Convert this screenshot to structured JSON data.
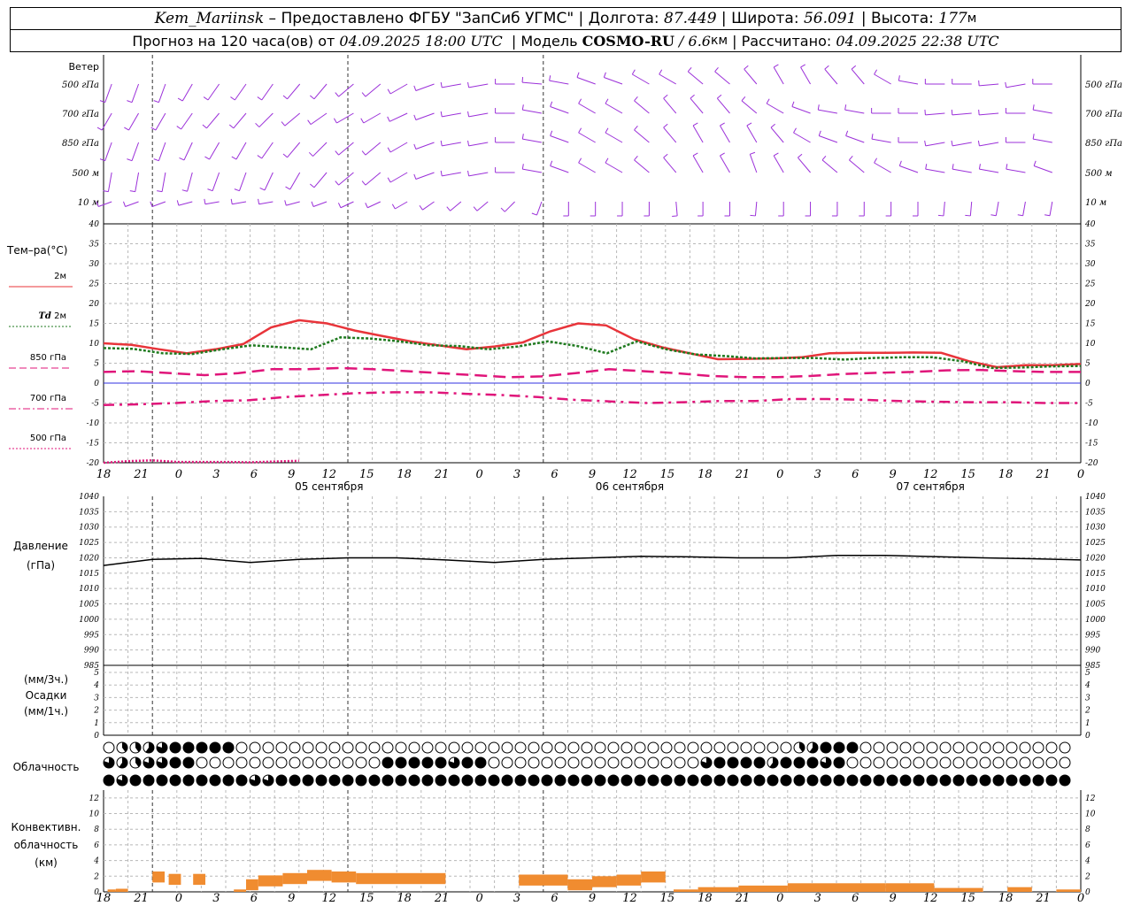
{
  "header": {
    "line1": {
      "station": "Kem_Mariinsk",
      "dash": " – ",
      "provider": "Предоставлено ФГБУ \"ЗапСиб УГМС\"",
      "sep": " | ",
      "lon_label": "Долгота: ",
      "lon_value": "87.449",
      "lat_label": "Широта: ",
      "lat_value": "56.091",
      "alt_label": "Высота: ",
      "alt_value": "177",
      "alt_unit": "м"
    },
    "line2": {
      "forecast_label": "Прогноз на 120 часа(ов) от ",
      "forecast_start": "04.09.2025 18:00 UTC",
      "model_sep": "  | Модель ",
      "model_name": "COSMO-RU",
      "model_res": " / 6.6",
      "model_res_unit": "км",
      "calc_label": " | Рассчитано: ",
      "calc_time": "04.09.2025 22:38 UTC"
    }
  },
  "colors": {
    "wind": "#9b30d9",
    "t2m": "#e8343a",
    "td2m": "#1f7a1f",
    "t850": "#e0157a",
    "zero_line": "#3030e0",
    "pressure": "#000000",
    "convective": "#f08c30",
    "grid": "#b8b8b8"
  },
  "time_axis": {
    "hour_labels": [
      "18",
      "21",
      "0",
      "3",
      "6",
      "9",
      "12",
      "15",
      "18",
      "21",
      "0",
      "3",
      "6",
      "9",
      "12",
      "15",
      "18",
      "21",
      "0",
      "3",
      "6",
      "9",
      "12",
      "15",
      "18",
      "21",
      "0"
    ],
    "date_labels": [
      "05 сентября",
      "06 сентября",
      "07 сентября"
    ]
  },
  "wind_panel": {
    "title": "Ветер",
    "levels": [
      "500 гПа",
      "700 гПа",
      "850 гПа",
      "500 м",
      "10  м"
    ],
    "levels_right": [
      "500 гПа",
      "700 гПа",
      "850 гПа",
      "500 м",
      "10  м"
    ]
  },
  "temperature_panel": {
    "title": "Тем–ра(°C)",
    "legend": [
      {
        "prefix": "",
        "label": "2м"
      },
      {
        "prefix": "Td",
        "label": " 2м"
      },
      {
        "prefix": "",
        "label": "850 гПа"
      },
      {
        "prefix": "",
        "label": "700 гПа"
      },
      {
        "prefix": "",
        "label": "500 гПа"
      }
    ]
  },
  "pressure_panel": {
    "title": "Давление",
    "unit": "(гПа)"
  },
  "precip_panel": {
    "line1": "(мм/3ч.)",
    "line2": "Осадки",
    "line3": "(мм/1ч.)"
  },
  "cloud_panel": {
    "title": "Облачность"
  },
  "convective_panel": {
    "line1": "Конвективн.",
    "line2": "облачность",
    "line3": "(км)"
  },
  "chart_data": [
    {
      "type": "line",
      "title": "Тем–ра(°C)",
      "ylim": [
        -20,
        40
      ],
      "yticks": [
        -20,
        -15,
        -10,
        -5,
        0,
        5,
        10,
        15,
        20,
        25,
        30,
        35,
        40
      ],
      "x_hours": [
        0,
        3,
        6,
        9,
        12,
        15,
        18,
        21,
        24,
        27,
        30,
        33,
        36,
        39,
        42,
        45,
        48,
        51,
        54,
        57,
        60,
        63,
        66,
        69,
        72,
        75,
        78,
        81,
        84,
        87,
        90,
        93,
        96,
        99,
        102,
        105,
        108,
        111,
        114,
        117,
        120
      ],
      "series": [
        {
          "name": "2м",
          "values": [
            10,
            9.6,
            8.5,
            7.5,
            8.5,
            9.8,
            14,
            15.8,
            15,
            13.2,
            11.8,
            10.5,
            9.5,
            8.5,
            9.2,
            10.2,
            13,
            15,
            14.5,
            11,
            9,
            7.5,
            6,
            6.1,
            6.2,
            6.5,
            7.5,
            7.6,
            7.6,
            7.7,
            7.6,
            5.5,
            4,
            4.5,
            4.5,
            4.8
          ]
        },
        {
          "name": "Td 2м",
          "values": [
            8.8,
            8.6,
            7.5,
            7.3,
            8.5,
            9.5,
            9,
            8.5,
            11.5,
            11.2,
            10.5,
            9.5,
            9.3,
            8.5,
            9.2,
            10.5,
            9.3,
            7.5,
            10.5,
            8.5,
            7.2,
            6.8,
            6.2,
            6.3,
            6.3,
            5.9,
            6.3,
            6.5,
            6.5,
            5.5,
            3.8,
            3.9,
            4.2,
            4.3
          ]
        },
        {
          "name": "850 гПа",
          "values": [
            2.8,
            3,
            2.5,
            2,
            2.5,
            3.5,
            3.5,
            3.8,
            3.5,
            3,
            2.5,
            2,
            1.5,
            1.7,
            2.5,
            3.5,
            3,
            2.5,
            1.8,
            1.5,
            1.5,
            1.8,
            2.3,
            2.6,
            2.8,
            3.2,
            3.3,
            3,
            2.8,
            2.8
          ]
        },
        {
          "name": "700 гПа",
          "values": [
            -5.5,
            -5.3,
            -5,
            -4.5,
            -4.3,
            -3.5,
            -3,
            -2.5,
            -2.3,
            -2.3,
            -2.7,
            -3,
            -3.5,
            -4.2,
            -4.6,
            -5,
            -4.8,
            -4.5,
            -4.5,
            -4,
            -4,
            -4.2,
            -4.5,
            -4.7,
            -4.8,
            -4.8,
            -5,
            -5
          ]
        },
        {
          "name": "500 гПа",
          "values": [
            -20,
            -19.6,
            -19.4,
            -19.8,
            -19.8,
            -19.8,
            -19.9,
            -19.7,
            -19.5
          ]
        }
      ]
    },
    {
      "type": "line",
      "title": "Давление",
      "ylim": [
        985,
        1040
      ],
      "yticks": [
        985,
        990,
        995,
        1000,
        1005,
        1010,
        1015,
        1020,
        1025,
        1030,
        1035,
        1040
      ],
      "x_hours": [
        0,
        6,
        12,
        18,
        24,
        30,
        36,
        42,
        48,
        54,
        60,
        66,
        72,
        78,
        84,
        90,
        96,
        102,
        108,
        114,
        120
      ],
      "series": [
        {
          "name": "",
          "values": [
            1017.5,
            1019.5,
            1019.8,
            1018.5,
            1019.5,
            1020,
            1020,
            1019.3,
            1018.5,
            1019.5,
            1020,
            1020.5,
            1020.3,
            1020,
            1020,
            1020.8,
            1020.8,
            1020.4,
            1020,
            1019.7,
            1019.3
          ]
        }
      ]
    },
    {
      "type": "bar",
      "title": "Осадки",
      "ylim": [
        0,
        5
      ],
      "yticks": [
        0,
        1,
        2,
        3,
        4,
        5
      ],
      "values": []
    },
    {
      "type": "bar",
      "title": "Конвективн. облачность (км)",
      "ylim": [
        0,
        13
      ],
      "yticks": [
        0,
        2,
        4,
        6,
        8,
        10,
        12
      ],
      "bars_km": [
        [
          0.5,
          1.5,
          0.3
        ],
        [
          1.5,
          3,
          0.4
        ],
        [
          6,
          7.5,
          2.6
        ],
        [
          8,
          9.5,
          2.3
        ],
        [
          11,
          12.5,
          2.3
        ],
        [
          16,
          17.5,
          0.3
        ],
        [
          17.5,
          19,
          1.6
        ],
        [
          19,
          22,
          2.1
        ],
        [
          22,
          25,
          2.4
        ],
        [
          25,
          28,
          2.8
        ],
        [
          28,
          31,
          2.6
        ],
        [
          31,
          42,
          2.4
        ],
        [
          51,
          57,
          2.2
        ],
        [
          57,
          60,
          1.6
        ],
        [
          60,
          63,
          2.0
        ],
        [
          63,
          66,
          2.2
        ],
        [
          66,
          69,
          2.6
        ],
        [
          70,
          73,
          0.3
        ],
        [
          73,
          78,
          0.6
        ],
        [
          78,
          84,
          0.8
        ],
        [
          84,
          90,
          1.1
        ],
        [
          90,
          96,
          1.1
        ],
        [
          96,
          102,
          1.1
        ],
        [
          102,
          108,
          0.5
        ],
        [
          111,
          114,
          0.6
        ],
        [
          117,
          120,
          0.3
        ]
      ]
    }
  ]
}
